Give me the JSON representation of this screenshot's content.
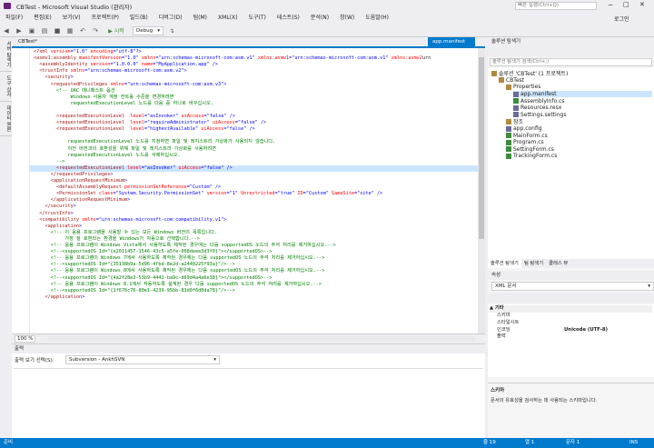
{
  "window": {
    "title": "CBTest - Microsoft Visual Studio (관리자)",
    "quick_launch_placeholder": "빠른 실행(Ctrl+Q)",
    "login": "로그인"
  },
  "menu": [
    "파일(F)",
    "편집(E)",
    "보기(V)",
    "프로젝트(P)",
    "빌드(B)",
    "디버그(D)",
    "팀(M)",
    "XML(X)",
    "도구(T)",
    "테스트(S)",
    "분석(N)",
    "창(W)",
    "도움말(H)"
  ],
  "toolbar": {
    "start_label": "▶ 시작",
    "config": "Debug"
  },
  "left_tabs": [
    "서버 탐색기",
    "도구 상자",
    "데이터 원본"
  ],
  "doc_tabs": {
    "left": "CBTest*",
    "active": "app.manifest"
  },
  "editor": {
    "zoom": "100 %",
    "lines": [
      "<?xml version=\"1.0\" encoding=\"utf-8\"?>",
      "<asmv1:assembly manifestVersion=\"1.0\" xmlns=\"urn:schemas-microsoft-com:asm.v1\" xmlns:asmv1=\"urn:schemas-microsoft-com:asm.v1\" xmlns:asmv2=\"urn",
      "  <assemblyIdentity version=\"1.0.0.0\" name=\"MyApplication.app\" />",
      "  <trustInfo xmlns=\"urn:schemas-microsoft-com:asm.v2\">",
      "    <security>",
      "      <requestedPrivileges xmlns=\"urn:schemas-microsoft-com:asm.v3\">",
      "        <!-- UAC 매니페스트 옵션",
      "             Windows 사용자 계정 컨트롤 수준을 변경하려면",
      "             requestedExecutionLevel 노드를 다음 중 하나로 바꾸십시오.",
      "",
      "        <requestedExecutionLevel  level=\"asInvoker\" uiAccess=\"false\" />",
      "        <requestedExecutionLevel  level=\"requireAdministrator\" uiAccess=\"false\" />",
      "        <requestedExecutionLevel  level=\"highestAvailable\" uiAccess=\"false\" />",
      "",
      "            requestedExecutionLevel 노드를 지정하면 파일 및 레지스트리 가상화가 사용되지 않습니다.",
      "            이전 버전과의 호환성을 위해 파일 및 레지스트리 가상화를 사용하려면",
      "            requestedExecutionLevel 노드를 삭제하십시오.",
      "        -->",
      "        <requestedExecutionLevel level=\"asInvoker\" uiAccess=\"false\" />",
      "      </requestedPrivileges>",
      "      <applicationRequestMinimum>",
      "        <defaultAssemblyRequest permissionSetReference=\"Custom\" />",
      "        <PermissionSet class=\"System.Security.PermissionSet\" version=\"1\" Unrestricted=\"true\" ID=\"Custom\" SameSite=\"site\" />",
      "      </applicationRequestMinimum>",
      "    </security>",
      "  </trustInfo>",
      "  <compatibility xmlns=\"urn:schemas-microsoft-com:compatibility.v1\">",
      "    <application>",
      "      <!-- 이 응용 프로그램을 사용할 수 있는 모든 Windows 버전의 목록입니다.",
      "           가장 잘 호환되는 환경을 Windows가 자동으로 선택합니다.-->",
      "      <!-- 응용 프로그램이 Windows Vista에서 사용하도록 제작된 경우에는 다음 supportedOS 노드의 주석 처리를 제거하십시오.-->",
      "      <!--<supportedOS Id=\"{e2011457-1546-43c5-a5fe-008deee3d3f0}\"></supportedOS>-->",
      "      <!-- 응용 프로그램이 Windows 7에서 사용하도록 제작된 경우에는 다음 supportedOS 노드의 주석 처리를 제거하십시오.-->",
      "      <!--<supportedOS Id=\"{35138b9a-5d96-4fbd-8e2d-a2440225f93a}\"/>-->",
      "      <!-- 응용 프로그램이 Windows 8에서 사용하도록 제작된 경우에는 다음 supportedOS 노드의 주석 처리를 제거하십시오.-->",
      "      <!--<supportedOS Id=\"{4a2f28e3-53b9-4441-ba9c-d69d4a4a6e38}\"></supportedOS>-->",
      "      <!-- 응용 프로그램이 Windows 8.1에서 작동하도록 설계된 경우 다음 supportedOS 노드의 주석 처리를 제거하십시오.-->",
      "      <!--<supportedOS Id=\"{1f676c76-80e1-4239-95bb-83d0f6d0da78}\"/>-->",
      "    </application>"
    ]
  },
  "output": {
    "title": "출력",
    "source_label": "출력 보기 선택(S):",
    "source_value": "Subversion - AnkhSVN"
  },
  "solution_explorer": {
    "title": "솔루션 탐색기",
    "search_placeholder": "솔루션 탐색기 검색(Ctrl+;)",
    "items": [
      {
        "label": "솔루션 'CBTest' (1 프로젝트)",
        "depth": 0,
        "sel": false
      },
      {
        "label": "CBTest",
        "depth": 1,
        "sel": false
      },
      {
        "label": "Properties",
        "depth": 2,
        "sel": false
      },
      {
        "label": "app.manifest",
        "depth": 3,
        "sel": true
      },
      {
        "label": "AssemblyInfo.cs",
        "depth": 3,
        "sel": false
      },
      {
        "label": "Resources.resx",
        "depth": 3,
        "sel": false
      },
      {
        "label": "Settings.settings",
        "depth": 3,
        "sel": false
      },
      {
        "label": "참조",
        "depth": 2,
        "sel": false
      },
      {
        "label": "app.config",
        "depth": 2,
        "sel": false
      },
      {
        "label": "MainForm.cs",
        "depth": 2,
        "sel": false
      },
      {
        "label": "Program.cs",
        "depth": 2,
        "sel": false
      },
      {
        "label": "SettingForm.cs",
        "depth": 2,
        "sel": false
      },
      {
        "label": "TrackingForm.cs",
        "depth": 2,
        "sel": false
      }
    ],
    "tabs": [
      "솔루션 탐색기",
      "팀 탐색기",
      "클래스 뷰"
    ]
  },
  "properties": {
    "title": "속성",
    "object": "XML 문서",
    "category": "기타",
    "rows": [
      {
        "name": "스키마",
        "value": ""
      },
      {
        "name": "스타일시트",
        "value": ""
      },
      {
        "name": "인코딩",
        "value": "Unicode (UTF-8)"
      },
      {
        "name": "출력",
        "value": ""
      }
    ],
    "desc_title": "스키마",
    "desc_text": "문서의 유효성을 검사하는 데 사용되는 스키마입니다."
  },
  "status": {
    "left": "준비",
    "line": "줄 19",
    "col": "열 1",
    "char": "문자 1",
    "mode": "INS"
  }
}
